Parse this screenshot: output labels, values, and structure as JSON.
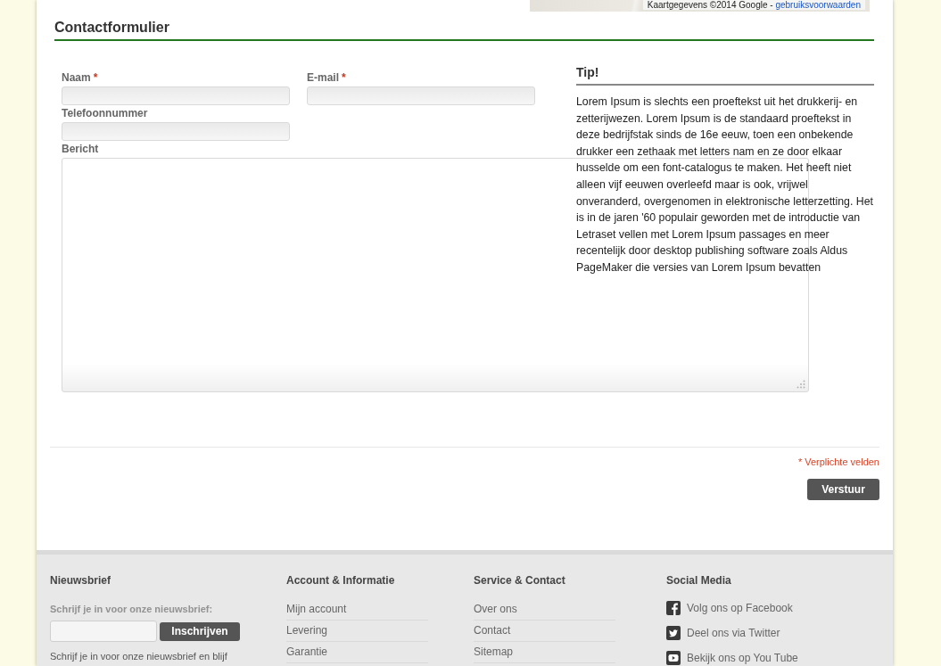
{
  "map": {
    "attribution": "Kaartgegevens ©2014 Google - ",
    "terms_link": "gebruiksvoorwaarden"
  },
  "form": {
    "title": "Contactformulier",
    "required_mark": "*",
    "fields": [
      {
        "label": "Naam",
        "required": true,
        "kind": "input"
      },
      {
        "label": "E-mail",
        "required": true,
        "kind": "input"
      },
      {
        "label": "Telefoonnummer",
        "required": false,
        "kind": "input"
      },
      {
        "label": "Bericht",
        "required": false,
        "kind": "textarea"
      }
    ],
    "required_note": "* Verplichte velden",
    "submit_button": "Verstuur"
  },
  "tip": {
    "title": "Tip!",
    "text": "Lorem Ipsum is slechts een proeftekst uit het drukkerij- en zetterijwezen. Lorem Ipsum is de standaard proeftekst in deze bedrijfstak sinds de 16e eeuw, toen een onbekende drukker een zethaak met letters nam en ze door elkaar husselde om een font-catalogus te maken. Het heeft niet alleen vijf eeuwen overleefd maar is ook, vrijwel onveranderd, overgenomen in elektronische letterzetting. Het is in de jaren '60 populair geworden met de introductie van Letraset vellen met Lorem Ipsum passages en meer recentelijk door desktop publishing software zoals Aldus PageMaker die versies van Lorem Ipsum bevatten"
  },
  "footer": {
    "newsletter": {
      "title": "Nieuwsbrief",
      "prompt": "Schrijf je in voor onze nieuwsbrief:",
      "button": "Inschrijven",
      "description": "Schrijf je in voor onze nieuwsbrief en blijf"
    },
    "link_columns": [
      {
        "title": "Account & Informatie",
        "links": [
          "Mijn account",
          "Levering",
          "Garantie"
        ]
      },
      {
        "title": "Service & Contact",
        "links": [
          "Over ons",
          "Contact",
          "Sitemap"
        ]
      }
    ],
    "social": {
      "title": "Social Media",
      "items": [
        {
          "kind": "facebook",
          "label": "Volg ons op Facebook"
        },
        {
          "kind": "twitter",
          "label": "Deel ons via Twitter"
        },
        {
          "kind": "youtube",
          "label": "Bekijk ons op You Tube"
        }
      ]
    }
  }
}
